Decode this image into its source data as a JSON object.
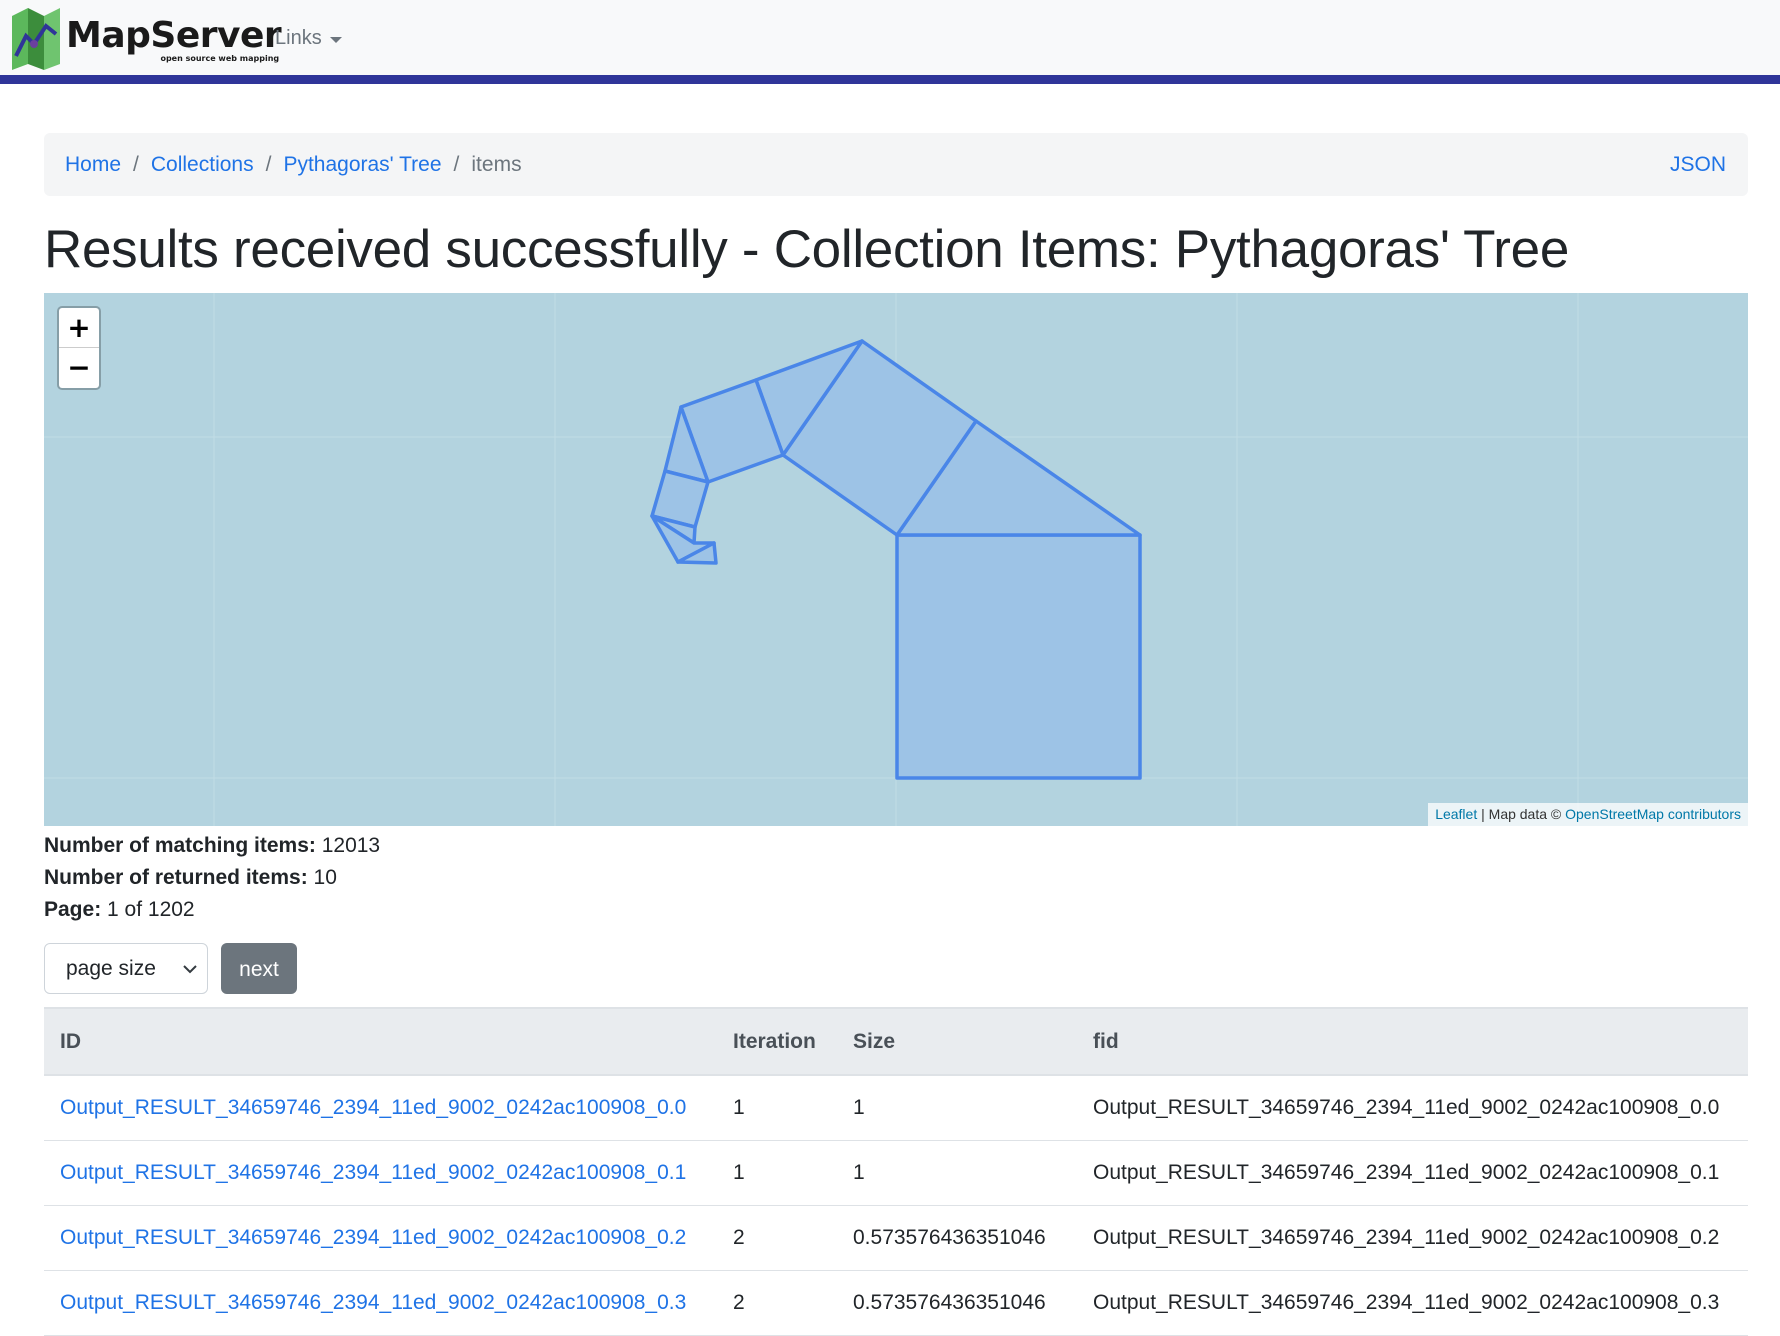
{
  "navbar": {
    "brand_name": "MapServer",
    "brand_tagline": "open source web mapping",
    "links_label": "Links",
    "accent_color": "#2f3599"
  },
  "breadcrumb": {
    "items": [
      "Home",
      "Collections",
      "Pythagoras' Tree"
    ],
    "current": "items",
    "json_label": "JSON"
  },
  "title": "Results received successfully - Collection Items: Pythagoras' Tree",
  "map": {
    "zoom_in": "+",
    "zoom_out": "−",
    "attribution": {
      "leaflet": "Leaflet",
      "separator": " | Map data © ",
      "osm": "OpenStreetMap contributors"
    },
    "feature_stroke": "#4a86e8",
    "feature_fill": "#9dc3e6",
    "background": "#b3d3df"
  },
  "stats": {
    "matching_label": "Number of matching items:",
    "matching_value": "12013",
    "returned_label": "Number of returned items:",
    "returned_value": "10",
    "page_label": "Page:",
    "page_value": "1 of 1202"
  },
  "controls": {
    "page_size_label": "page size",
    "next_label": "next"
  },
  "table": {
    "headers": [
      "ID",
      "Iteration",
      "Size",
      "fid"
    ],
    "rows": [
      {
        "id": "Output_RESULT_34659746_2394_11ed_9002_0242ac100908_0.0",
        "iteration": "1",
        "size": "1",
        "fid": "Output_RESULT_34659746_2394_11ed_9002_0242ac100908_0.0"
      },
      {
        "id": "Output_RESULT_34659746_2394_11ed_9002_0242ac100908_0.1",
        "iteration": "1",
        "size": "1",
        "fid": "Output_RESULT_34659746_2394_11ed_9002_0242ac100908_0.1"
      },
      {
        "id": "Output_RESULT_34659746_2394_11ed_9002_0242ac100908_0.2",
        "iteration": "2",
        "size": "0.573576436351046",
        "fid": "Output_RESULT_34659746_2394_11ed_9002_0242ac100908_0.2"
      },
      {
        "id": "Output_RESULT_34659746_2394_11ed_9002_0242ac100908_0.3",
        "iteration": "2",
        "size": "0.573576436351046",
        "fid": "Output_RESULT_34659746_2394_11ed_9002_0242ac100908_0.3"
      }
    ]
  }
}
